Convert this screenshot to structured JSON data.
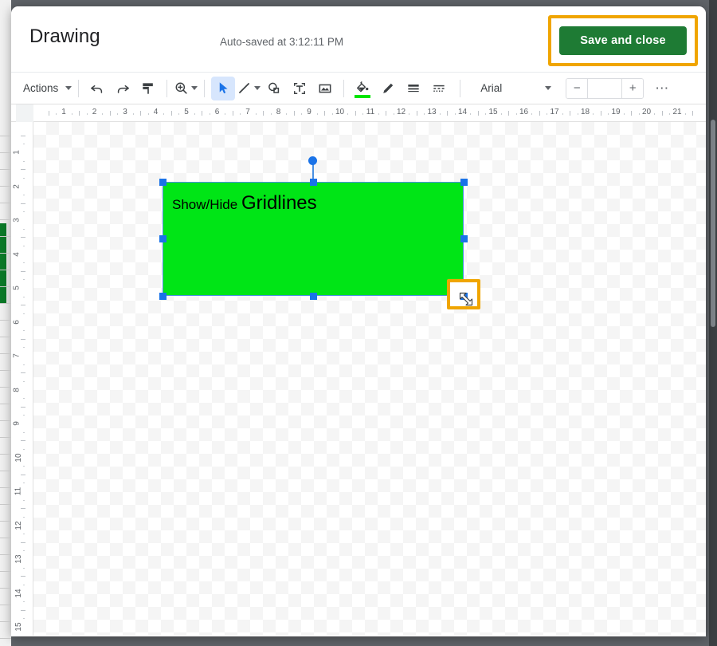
{
  "dialog": {
    "title": "Drawing",
    "autosave_status": "Auto-saved at 3:12:11 PM",
    "save_button_label": "Save and close"
  },
  "toolbar": {
    "actions_label": "Actions",
    "items": [
      {
        "name": "actions-menu",
        "label": "Actions",
        "icon": "caret-down"
      },
      {
        "name": "undo-button",
        "label": "",
        "icon": "undo-icon"
      },
      {
        "name": "redo-button",
        "label": "",
        "icon": "redo-icon"
      },
      {
        "name": "paint-format-button",
        "label": "",
        "icon": "paint-format-icon"
      },
      {
        "name": "zoom-button",
        "label": "",
        "icon": "zoom-in-icon"
      },
      {
        "name": "select-tool",
        "label": "",
        "icon": "cursor-arrow-icon"
      },
      {
        "name": "line-tool",
        "label": "",
        "icon": "line-icon"
      },
      {
        "name": "shape-tool",
        "label": "",
        "icon": "shape-icon"
      },
      {
        "name": "text-box-tool",
        "label": "",
        "icon": "text-box-icon"
      },
      {
        "name": "image-tool",
        "label": "",
        "icon": "image-icon"
      },
      {
        "name": "fill-color-tool",
        "label": "",
        "icon": "paint-bucket-icon"
      },
      {
        "name": "line-color-tool",
        "label": "",
        "icon": "pencil-icon"
      },
      {
        "name": "line-weight-tool",
        "label": "",
        "icon": "line-weight-icon"
      },
      {
        "name": "line-dash-tool",
        "label": "",
        "icon": "line-dash-icon"
      }
    ],
    "font_name": "Arial",
    "font_size_value": "",
    "font_size_decrease": "−",
    "font_size_increase": "+",
    "more_options": "⋯",
    "fill_color_hex": "#00e500",
    "active_tool": "select-tool"
  },
  "ruler": {
    "horizontal_labels": [
      "1",
      "2",
      "3",
      "4",
      "5",
      "6",
      "7",
      "8",
      "9",
      "10",
      "11",
      "12",
      "13",
      "14",
      "15",
      "16",
      "17",
      "18",
      "19",
      "20",
      "21"
    ],
    "vertical_labels": [
      "1",
      "2",
      "3",
      "4",
      "5",
      "6",
      "7",
      "8",
      "9",
      "10",
      "11",
      "12",
      "13",
      "14",
      "15"
    ]
  },
  "canvas": {
    "shape": {
      "fill_hex": "#00e516",
      "text_small": "Show/Hide",
      "text_large": "Gridlines",
      "selected": true
    },
    "selection": {
      "handle_color": "#1a73e8",
      "border_color": "#4a90e2",
      "highlight_color": "#f0a500"
    }
  }
}
